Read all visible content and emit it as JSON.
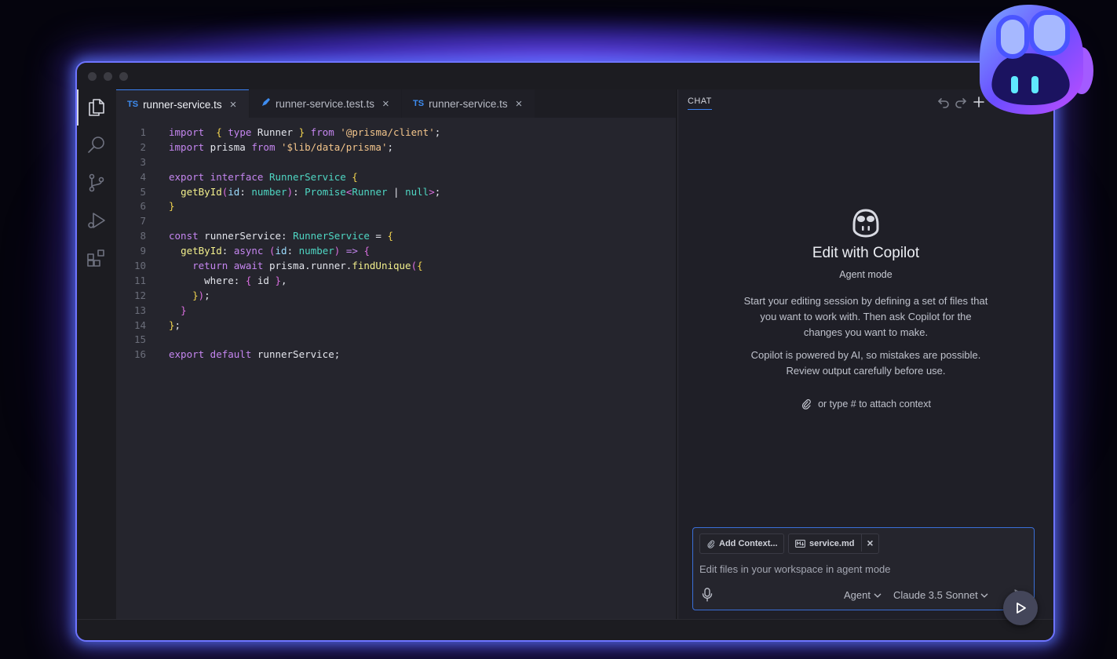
{
  "tabs": [
    {
      "badge": "TS",
      "label": "runner-service.ts",
      "close": "×"
    },
    {
      "label": "runner-service.test.ts",
      "close": "×"
    },
    {
      "badge": "TS",
      "label": "runner-service.ts",
      "close": "×"
    }
  ],
  "code_lines": [
    {
      "num": "1"
    },
    {
      "num": "2"
    },
    {
      "num": "3"
    },
    {
      "num": "4"
    },
    {
      "num": "5"
    },
    {
      "num": "6"
    },
    {
      "num": "7"
    },
    {
      "num": "8"
    },
    {
      "num": "9"
    },
    {
      "num": "10"
    },
    {
      "num": "11"
    },
    {
      "num": "12"
    },
    {
      "num": "13"
    },
    {
      "num": "14"
    },
    {
      "num": "15"
    },
    {
      "num": "16"
    }
  ],
  "code_tokens": [
    [
      [
        "kw",
        "import"
      ],
      [
        "",
        "  "
      ],
      [
        "br",
        "{"
      ],
      [
        "",
        ""
      ],
      [
        "kw",
        " type"
      ],
      [
        "",
        " Runner "
      ],
      [
        "br",
        "}"
      ],
      [
        "kw",
        " from"
      ],
      [
        "st",
        " '@prisma/client'"
      ],
      [
        "",
        ";"
      ]
    ],
    [
      [
        "kw",
        "import"
      ],
      [
        "",
        " prisma "
      ],
      [
        "kw",
        "from"
      ],
      [
        "st",
        " '$lib/data/prisma'"
      ],
      [
        "",
        ";"
      ]
    ],
    [],
    [
      [
        "kw",
        "export"
      ],
      [
        "kw",
        " interface"
      ],
      [
        "ty",
        " RunnerService"
      ],
      [
        "br",
        " {"
      ]
    ],
    [
      [
        "",
        "  "
      ],
      [
        "fn",
        "getById"
      ],
      [
        "br2",
        "("
      ],
      [
        "pr",
        "id"
      ],
      [
        "",
        ": "
      ],
      [
        "ty",
        "number"
      ],
      [
        "br2",
        ")"
      ],
      [
        "",
        ": "
      ],
      [
        "ty",
        "Promise"
      ],
      [
        "br2",
        "<"
      ],
      [
        "ty",
        "Runner"
      ],
      [
        "",
        " | "
      ],
      [
        "ty",
        "null"
      ],
      [
        "br2",
        ">"
      ],
      [
        "",
        ";"
      ]
    ],
    [
      [
        "br",
        "}"
      ]
    ],
    [],
    [
      [
        "kw",
        "const"
      ],
      [
        "",
        " runnerService: "
      ],
      [
        "ty",
        "RunnerService"
      ],
      [
        "",
        " = "
      ],
      [
        "br",
        "{"
      ]
    ],
    [
      [
        "",
        "  "
      ],
      [
        "fn",
        "getById"
      ],
      [
        "",
        ": "
      ],
      [
        "kw",
        "async"
      ],
      [
        "",
        " "
      ],
      [
        "br2",
        "("
      ],
      [
        "pr",
        "id"
      ],
      [
        "",
        ": "
      ],
      [
        "ty",
        "number"
      ],
      [
        "br2",
        ")"
      ],
      [
        "kw",
        " =>"
      ],
      [
        "",
        " "
      ],
      [
        "br2",
        "{"
      ]
    ],
    [
      [
        "",
        "    "
      ],
      [
        "kw",
        "return"
      ],
      [
        "kw",
        " await"
      ],
      [
        "",
        " prisma.runner."
      ],
      [
        "fn",
        "findUnique"
      ],
      [
        "br2",
        "("
      ],
      [
        "br",
        "{"
      ]
    ],
    [
      [
        "",
        "      where: "
      ],
      [
        "br2",
        "{"
      ],
      [
        "",
        " id "
      ],
      [
        "br2",
        "}"
      ],
      [
        "",
        ","
      ]
    ],
    [
      [
        "",
        "    "
      ],
      [
        "br",
        "}"
      ],
      [
        "br2",
        ")"
      ],
      [
        "",
        ";"
      ]
    ],
    [
      [
        "",
        "  "
      ],
      [
        "br2",
        "}"
      ]
    ],
    [
      [
        "br",
        "}"
      ],
      [
        "",
        ";"
      ]
    ],
    [],
    [
      [
        "kw",
        "export"
      ],
      [
        "kw",
        " default"
      ],
      [
        "",
        " runnerService;"
      ]
    ]
  ],
  "chat": {
    "tab_label": "CHAT",
    "title": "Edit with Copilot",
    "subtitle": "Agent mode",
    "paragraph1": "Start your editing session by defining a set of files that you want to work with. Then ask Copilot for the changes you want to make.",
    "paragraph2": "Copilot is powered by AI, so mistakes are possible. Review output carefully before use.",
    "attach_hint": "or type # to attach context",
    "add_context": "Add Context...",
    "file_chip": "service.md",
    "placeholder": "Edit files in your workspace in agent mode",
    "mode": "Agent",
    "model": "Claude 3.5 Sonnet"
  },
  "colors": {
    "accent": "#3b82f6",
    "glow": "#6e74ff"
  }
}
